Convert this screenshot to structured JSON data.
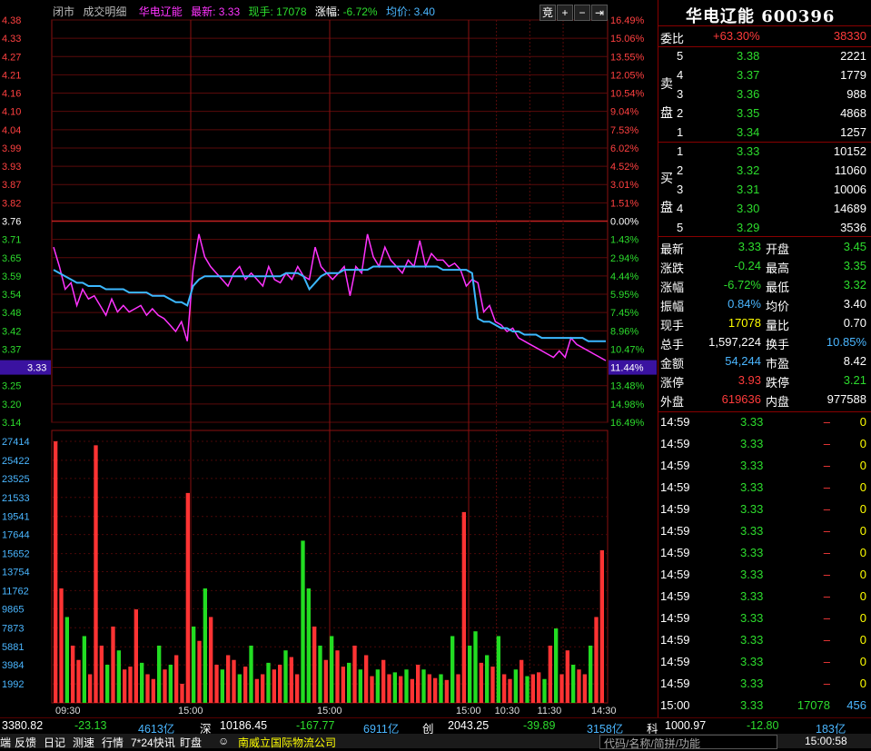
{
  "header": {
    "tab_closed": "闭市",
    "tab_trades": "成交明细",
    "stock_name": "华电辽能",
    "latest_label": "最新:",
    "latest_value": "3.33",
    "cur_vol_label": "现手:",
    "cur_vol_value": "17078",
    "change_label": "涨幅:",
    "change_value": "-6.72%",
    "avg_label": "均价:",
    "avg_value": "3.40",
    "btn_auction": "竞",
    "btn_plus": "+",
    "btn_minus": "−",
    "btn_end": "⇥"
  },
  "price_axis": {
    "left": [
      "4.38",
      "4.33",
      "4.27",
      "4.21",
      "4.16",
      "4.10",
      "4.04",
      "3.99",
      "3.93",
      "3.87",
      "3.82",
      "3.76",
      "3.71",
      "3.65",
      "3.59",
      "3.54",
      "3.48",
      "3.42",
      "3.37",
      "3.33",
      "3.25",
      "3.20",
      "3.14"
    ],
    "right": [
      "16.49%",
      "15.06%",
      "13.55%",
      "12.05%",
      "10.54%",
      "9.04%",
      "7.53%",
      "6.02%",
      "4.52%",
      "3.01%",
      "1.51%",
      "0.00%",
      "1.43%",
      "2.94%",
      "4.44%",
      "5.95%",
      "7.45%",
      "8.96%",
      "10.47%",
      "11.44%",
      "13.48%",
      "14.98%",
      "16.49%"
    ]
  },
  "volume_axis": [
    "27414",
    "25422",
    "23525",
    "21533",
    "19541",
    "17644",
    "15652",
    "13754",
    "11762",
    "9865",
    "7873",
    "5881",
    "3984",
    "1992"
  ],
  "time_axis": [
    "09:30",
    "15:00",
    "15:00",
    "15:00",
    "10:30",
    "11:30",
    "14:30"
  ],
  "chart_data": {
    "type": "line",
    "title": "",
    "prev_close": 3.76,
    "ylim": [
      3.14,
      4.38
    ],
    "series": [
      {
        "name": "",
        "values": [
          3.68,
          3.62,
          3.55,
          3.57,
          3.5,
          3.55,
          3.52,
          3.53,
          3.5,
          3.47,
          3.52,
          3.48,
          3.5,
          3.48,
          3.49,
          3.5,
          3.47,
          3.49,
          3.47,
          3.46,
          3.44,
          3.42,
          3.45,
          3.39,
          3.61,
          3.72,
          3.65,
          3.62,
          3.6,
          3.58,
          3.56,
          3.6,
          3.62,
          3.58,
          3.6,
          3.58,
          3.56,
          3.62,
          3.58,
          3.57,
          3.6,
          3.58,
          3.62,
          3.59,
          3.58,
          3.68,
          3.62,
          3.6,
          3.58,
          3.6,
          3.62,
          3.53,
          3.62,
          3.6,
          3.72,
          3.65,
          3.62,
          3.68,
          3.64,
          3.62,
          3.6,
          3.64,
          3.62,
          3.7,
          3.62,
          3.66,
          3.64,
          3.64,
          3.62,
          3.63,
          3.61,
          3.56,
          3.58,
          3.57,
          3.48,
          3.5,
          3.45,
          3.44,
          3.42,
          3.43,
          3.4,
          3.39,
          3.38,
          3.37,
          3.36,
          3.35,
          3.34,
          3.36,
          3.34,
          3.4,
          3.38,
          3.37,
          3.36,
          3.35,
          3.34,
          3.33
        ]
      },
      {
        "name": "",
        "values": [
          3.61,
          3.6,
          3.59,
          3.58,
          3.57,
          3.57,
          3.56,
          3.56,
          3.56,
          3.55,
          3.55,
          3.55,
          3.55,
          3.54,
          3.54,
          3.54,
          3.54,
          3.53,
          3.53,
          3.53,
          3.52,
          3.51,
          3.51,
          3.5,
          3.56,
          3.58,
          3.59,
          3.59,
          3.59,
          3.59,
          3.59,
          3.59,
          3.59,
          3.59,
          3.59,
          3.59,
          3.59,
          3.59,
          3.59,
          3.59,
          3.6,
          3.6,
          3.6,
          3.59,
          3.55,
          3.57,
          3.59,
          3.6,
          3.6,
          3.6,
          3.61,
          3.61,
          3.61,
          3.61,
          3.61,
          3.62,
          3.62,
          3.62,
          3.62,
          3.62,
          3.62,
          3.62,
          3.62,
          3.62,
          3.62,
          3.62,
          3.62,
          3.61,
          3.61,
          3.61,
          3.61,
          3.61,
          3.6,
          3.46,
          3.45,
          3.45,
          3.44,
          3.43,
          3.43,
          3.42,
          3.42,
          3.41,
          3.41,
          3.41,
          3.4,
          3.4,
          3.4,
          3.4,
          3.4,
          3.4,
          3.4,
          3.4,
          3.39,
          3.39,
          3.39,
          3.39
        ]
      }
    ],
    "volume_bars": [
      27414,
      12000,
      9000,
      6000,
      4500,
      7000,
      3000,
      27000,
      6000,
      4000,
      8000,
      5500,
      3500,
      3800,
      9800,
      4200,
      3000,
      2500,
      6000,
      3500,
      4000,
      5000,
      2000,
      22000,
      8000,
      6500,
      12000,
      9000,
      4000,
      3500,
      5000,
      4500,
      3000,
      3800,
      6000,
      2500,
      3000,
      4200,
      3500,
      4000,
      5500,
      4800,
      3000,
      17000,
      12000,
      8000,
      6000,
      4500,
      7000,
      5500,
      3800,
      4200,
      6000,
      3500,
      5000,
      2800,
      3500,
      4500,
      3000,
      3200,
      2800,
      3500,
      2500,
      4000,
      3500,
      3000,
      2600,
      3000,
      2400,
      7000,
      3000,
      20000,
      6000,
      7500,
      4200,
      5000,
      3800,
      7000,
      3000,
      2500,
      3500,
      4500,
      2800,
      3000,
      3200,
      2500,
      6000,
      7800,
      3000,
      5500,
      4000,
      3500,
      3000,
      6000,
      9000,
      16000
    ],
    "volume_up": [
      true,
      true,
      false,
      true,
      true,
      false,
      true,
      true,
      true,
      false,
      true,
      false,
      true,
      true,
      true,
      false,
      true,
      true,
      false,
      true,
      false,
      true,
      true,
      true,
      false,
      true,
      false,
      true,
      true,
      false,
      true,
      true,
      false,
      true,
      false,
      true,
      true,
      false,
      true,
      true,
      false,
      true,
      true,
      false,
      false,
      true,
      false,
      true,
      false,
      true,
      true,
      false,
      true,
      false,
      true,
      true,
      false,
      true,
      true,
      false,
      true,
      false,
      true,
      true,
      false,
      true,
      true,
      false,
      true,
      false,
      true,
      true,
      false,
      false,
      true,
      false,
      true,
      false,
      true,
      true,
      false,
      true,
      false,
      true,
      true,
      false,
      true,
      false,
      true,
      true,
      false,
      true,
      true,
      false,
      true,
      true
    ]
  },
  "right_panel": {
    "title": "华电辽能 600396",
    "weibi_label": "委比",
    "weibi_value": "+63.30%",
    "weicha_value": "38330",
    "sell_label": "卖盘",
    "buy_label": "买盘",
    "sell": [
      {
        "lvl": "5",
        "price": "3.38",
        "vol": "2221"
      },
      {
        "lvl": "4",
        "price": "3.37",
        "vol": "1779"
      },
      {
        "lvl": "3",
        "price": "3.36",
        "vol": "988"
      },
      {
        "lvl": "2",
        "price": "3.35",
        "vol": "4868"
      },
      {
        "lvl": "1",
        "price": "3.34",
        "vol": "1257"
      }
    ],
    "buy": [
      {
        "lvl": "1",
        "price": "3.33",
        "vol": "10152"
      },
      {
        "lvl": "2",
        "price": "3.32",
        "vol": "11060"
      },
      {
        "lvl": "3",
        "price": "3.31",
        "vol": "10006"
      },
      {
        "lvl": "4",
        "price": "3.30",
        "vol": "14689"
      },
      {
        "lvl": "5",
        "price": "3.29",
        "vol": "3536"
      }
    ],
    "stats": [
      {
        "l1": "最新",
        "v1": "3.33",
        "l2": "开盘",
        "v2": "3.45"
      },
      {
        "l1": "涨跌",
        "v1": "-0.24",
        "l2": "最高",
        "v2": "3.35"
      },
      {
        "l1": "涨幅",
        "v1": "-6.72%",
        "l2": "最低",
        "v2": "3.32"
      },
      {
        "l1": "振幅",
        "v1": "0.84%",
        "l2": "均价",
        "v2": "3.40"
      },
      {
        "l1": "现手",
        "v1": "17078",
        "l2": "量比",
        "v2": "0.70"
      },
      {
        "l1": "总手",
        "v1": "1,597,224",
        "l2": "换手",
        "v2": "10.85%"
      },
      {
        "l1": "金额",
        "v1": "54,244",
        "l2": "市盈",
        "v2": "8.42"
      },
      {
        "l1": "涨停",
        "v1": "3.93",
        "l2": "跌停",
        "v2": "3.21"
      },
      {
        "l1": "外盘",
        "v1": "619636",
        "l2": "内盘",
        "v2": "977588"
      }
    ],
    "ticks": [
      {
        "t": "14:59",
        "p": "3.33",
        "v": "–",
        "n": "0"
      },
      {
        "t": "14:59",
        "p": "3.33",
        "v": "–",
        "n": "0"
      },
      {
        "t": "14:59",
        "p": "3.33",
        "v": "–",
        "n": "0"
      },
      {
        "t": "14:59",
        "p": "3.33",
        "v": "–",
        "n": "0"
      },
      {
        "t": "14:59",
        "p": "3.33",
        "v": "–",
        "n": "0"
      },
      {
        "t": "14:59",
        "p": "3.33",
        "v": "–",
        "n": "0"
      },
      {
        "t": "14:59",
        "p": "3.33",
        "v": "–",
        "n": "0"
      },
      {
        "t": "14:59",
        "p": "3.33",
        "v": "–",
        "n": "0"
      },
      {
        "t": "14:59",
        "p": "3.33",
        "v": "–",
        "n": "0"
      },
      {
        "t": "14:59",
        "p": "3.33",
        "v": "–",
        "n": "0"
      },
      {
        "t": "14:59",
        "p": "3.33",
        "v": "–",
        "n": "0"
      },
      {
        "t": "14:59",
        "p": "3.33",
        "v": "–",
        "n": "0"
      },
      {
        "t": "14:59",
        "p": "3.33",
        "v": "–",
        "n": "0"
      },
      {
        "t": "15:00",
        "p": "3.33",
        "v": "17078",
        "n": "456"
      }
    ]
  },
  "index_bar": {
    "sh_val": "3380.82",
    "sh_chg": "-23.13",
    "sh_amt": "4613亿",
    "sz_label": "深",
    "sz_val": "10186.45",
    "sz_chg": "-167.77",
    "sz_amt": "6911亿",
    "cy_label": "创",
    "cy_val": "2043.25",
    "cy_chg": "-39.89",
    "cy_amt": "3158亿",
    "kc_label": "科",
    "kc_val": "1000.97",
    "kc_chg": "-12.80",
    "kc_amt": "183亿"
  },
  "bottom_bar": {
    "items": [
      "端",
      "反馈",
      "日记",
      "测速",
      "行情",
      "7*24快讯",
      "盯盘"
    ],
    "broker": "南威立国际物流公司",
    "search_placeholder": "代码/名称/简拼/功能",
    "clock": "15:00:58"
  }
}
